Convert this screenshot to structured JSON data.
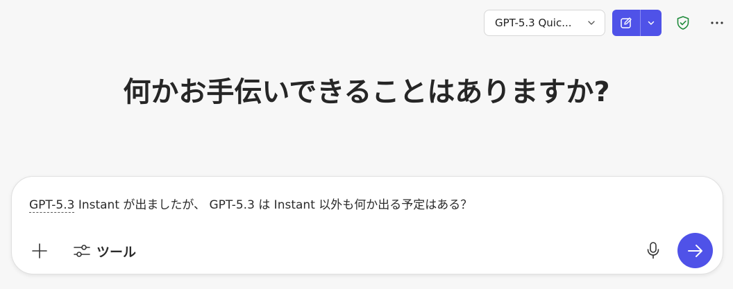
{
  "header": {
    "model_selector": {
      "value": "GPT-5.3 Quic..."
    },
    "new_chat_icon": "compose-icon",
    "dropdown_icon": "chevron-down-icon",
    "privacy_icon": "shield-check-icon",
    "more_icon": "more-horizontal-icon"
  },
  "main": {
    "greeting": "何かお手伝いできることはありますか?"
  },
  "composer": {
    "input_underlined": "GPT-5.3",
    "input_rest": " Instant が出ましたが、 GPT-5.3 は Instant 以外も何か出る予定はある？",
    "tools_label": "ツール",
    "add_icon": "plus-icon",
    "tools_icon": "sliders-icon",
    "mic_icon": "microphone-icon",
    "send_icon": "arrow-right-icon"
  },
  "colors": {
    "accent": "#4f52e8",
    "shield": "#1e8a3a",
    "background": "#f7f7f7"
  }
}
